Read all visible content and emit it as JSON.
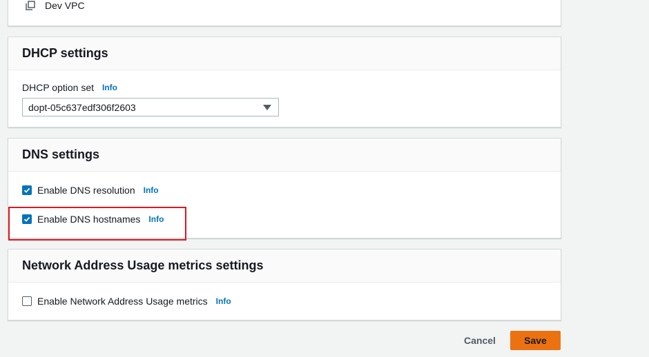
{
  "vpc": {
    "name": "Dev VPC",
    "icon": "copy-icon"
  },
  "dhcp": {
    "title": "DHCP settings",
    "option_set_label": "DHCP option set",
    "info": "Info",
    "selected_option": "dopt-05c637edf306f2603"
  },
  "dns": {
    "title": "DNS settings",
    "resolution_label": "Enable DNS resolution",
    "resolution_checked": true,
    "hostnames_label": "Enable DNS hostnames",
    "hostnames_checked": true,
    "info": "Info"
  },
  "nau": {
    "title": "Network Address Usage metrics settings",
    "metrics_label": "Enable Network Address Usage metrics",
    "metrics_checked": false,
    "info": "Info"
  },
  "actions": {
    "cancel_label": "Cancel",
    "save_label": "Save"
  },
  "colors": {
    "primary": "#ec7211",
    "link": "#0073bb",
    "highlight": "#e0161e",
    "checkbox": "#0073bb"
  }
}
